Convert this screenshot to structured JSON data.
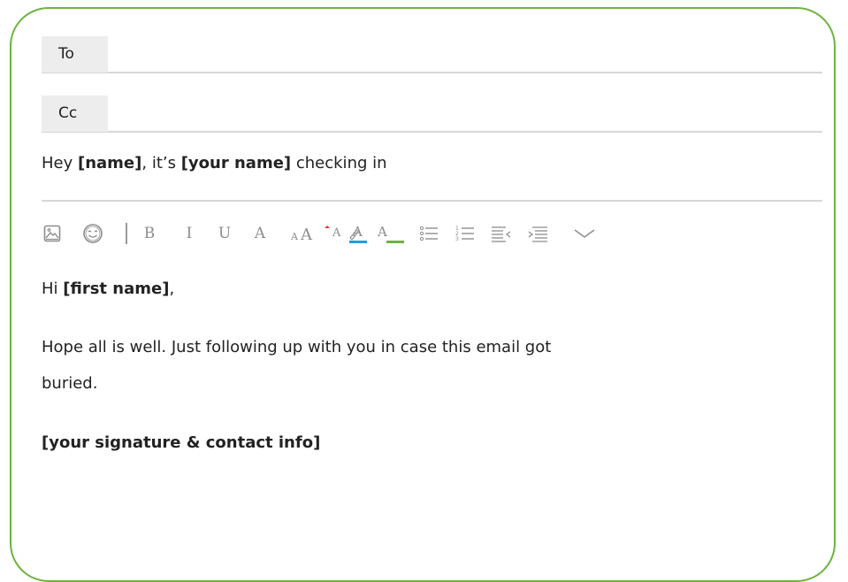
{
  "compose": {
    "to_label": "To",
    "cc_label": "Cc",
    "subject": {
      "prefix": "Hey ",
      "name": "[name]",
      "middle": ", it’s ",
      "your_name": "[your name]",
      "suffix": " checking in"
    }
  },
  "toolbar": {
    "tools": [
      "image-icon",
      "emoji-icon",
      "bold-icon",
      "italic-icon",
      "underline-icon",
      "font-icon",
      "font-size-icon",
      "superscript-icon",
      "text-color-icon",
      "highlight-icon",
      "bulleted-list-icon",
      "numbered-list-icon",
      "outdent-icon",
      "indent-icon",
      "more-chevron-icon"
    ],
    "bold_glyph": "B",
    "italic_glyph": "I",
    "underline_glyph": "U",
    "font_glyph": "A",
    "text_color_accent": "#1ba0e2",
    "highlight_accent": "#6db33f"
  },
  "body": {
    "greeting_prefix": "Hi ",
    "greeting_name": "[first name]",
    "greeting_suffix": ",",
    "line1": "Hope all is well. Just following up with you in case this email got",
    "line2": "buried.",
    "signature": "[your signature & contact info]"
  },
  "colors": {
    "frame_border": "#6db33f",
    "divider": "#d7d7d7",
    "label_bg": "#ededed",
    "icon_gray": "#8d8d8d"
  }
}
